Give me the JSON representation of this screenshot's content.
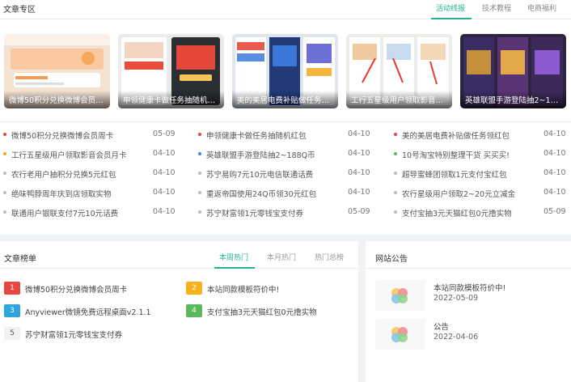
{
  "header": {
    "title": "文章专区",
    "tabs": [
      "活动线报",
      "技术教程",
      "电商福利"
    ]
  },
  "colors": {
    "accent": "#1fb58f",
    "dot_red": "#e8473f",
    "dot_orange": "#f5a623",
    "dot_blue": "#3c8de0",
    "dot_green": "#5cb85c",
    "dot_gray": "#bbbbbb",
    "badge_1": "#e8473f",
    "badge_2": "#f5b21a",
    "badge_3": "#2ea5dc",
    "badge_4": "#5cb85c"
  },
  "featured": [
    "微博50积分兑换微博会员周卡",
    "申领健康卡做任务抽随机红包",
    "美的美居电费补贴做任务领红包",
    "工行五星级用户领取影音会员月卡",
    "英雄联盟手游登陆抽2~188Q币"
  ],
  "articles": [
    {
      "title": "微博50积分兑换微博会员周卡",
      "date": "05-09",
      "dot": "red"
    },
    {
      "title": "申领健康卡做任务抽随机红包",
      "date": "04-10",
      "dot": "red"
    },
    {
      "title": "美的美居电费补贴做任务领红包",
      "date": "04-10",
      "dot": "red"
    },
    {
      "title": "工行五星级用户领取影音会员月卡",
      "date": "04-10",
      "dot": "orange"
    },
    {
      "title": "英雄联盟手游登陆抽2~188Q币",
      "date": "04-10",
      "dot": "blue"
    },
    {
      "title": "10号淘宝特别整理干货 买买买!",
      "date": "04-10",
      "dot": "green"
    },
    {
      "title": "农行老用户抽积分兑换5元红包",
      "date": "04-10",
      "dot": "gray"
    },
    {
      "title": "苏宁易购7元10元电信联通话费",
      "date": "04-10",
      "dot": "gray"
    },
    {
      "title": "超导蜜蜂团领取1元支付宝红包",
      "date": "04-10",
      "dot": "gray"
    },
    {
      "title": "绝味鸭脖周年庆到店领取实物",
      "date": "04-10",
      "dot": "gray"
    },
    {
      "title": "重返帝国使用24Q币领30元红包",
      "date": "04-10",
      "dot": "gray"
    },
    {
      "title": "农行星级用户领取2~20元立减金",
      "date": "04-10",
      "dot": "gray"
    },
    {
      "title": "联通用户银联支付7元10元话费",
      "date": "04-10",
      "dot": "gray"
    },
    {
      "title": "苏宁财富领1元零钱宝支付券",
      "date": "05-09",
      "dot": "gray"
    },
    {
      "title": "支付宝抽3元天猫红包0元撸实物",
      "date": "05-09",
      "dot": "gray"
    }
  ],
  "ranking": {
    "title": "文章榜单",
    "tabs": [
      "本周热门",
      "本月热门",
      "热门总榜"
    ],
    "items": [
      {
        "num": "1",
        "title": "微博50积分兑换微博会员周卡"
      },
      {
        "num": "2",
        "title": "本站同款模板符价中!"
      },
      {
        "num": "3",
        "title": "Anyviewer微镜免费远程桌面v2.1.1"
      },
      {
        "num": "4",
        "title": "支付宝抽3元天猫红包0元撸实物"
      },
      {
        "num": "5",
        "title": "苏宁财富领1元零钱宝支付券"
      }
    ]
  },
  "notices": {
    "title": "网站公告",
    "items": [
      {
        "title": "本站同款模板符价中!",
        "date": "2022-05-09"
      },
      {
        "title": "公告",
        "date": "2022-04-06"
      }
    ]
  }
}
